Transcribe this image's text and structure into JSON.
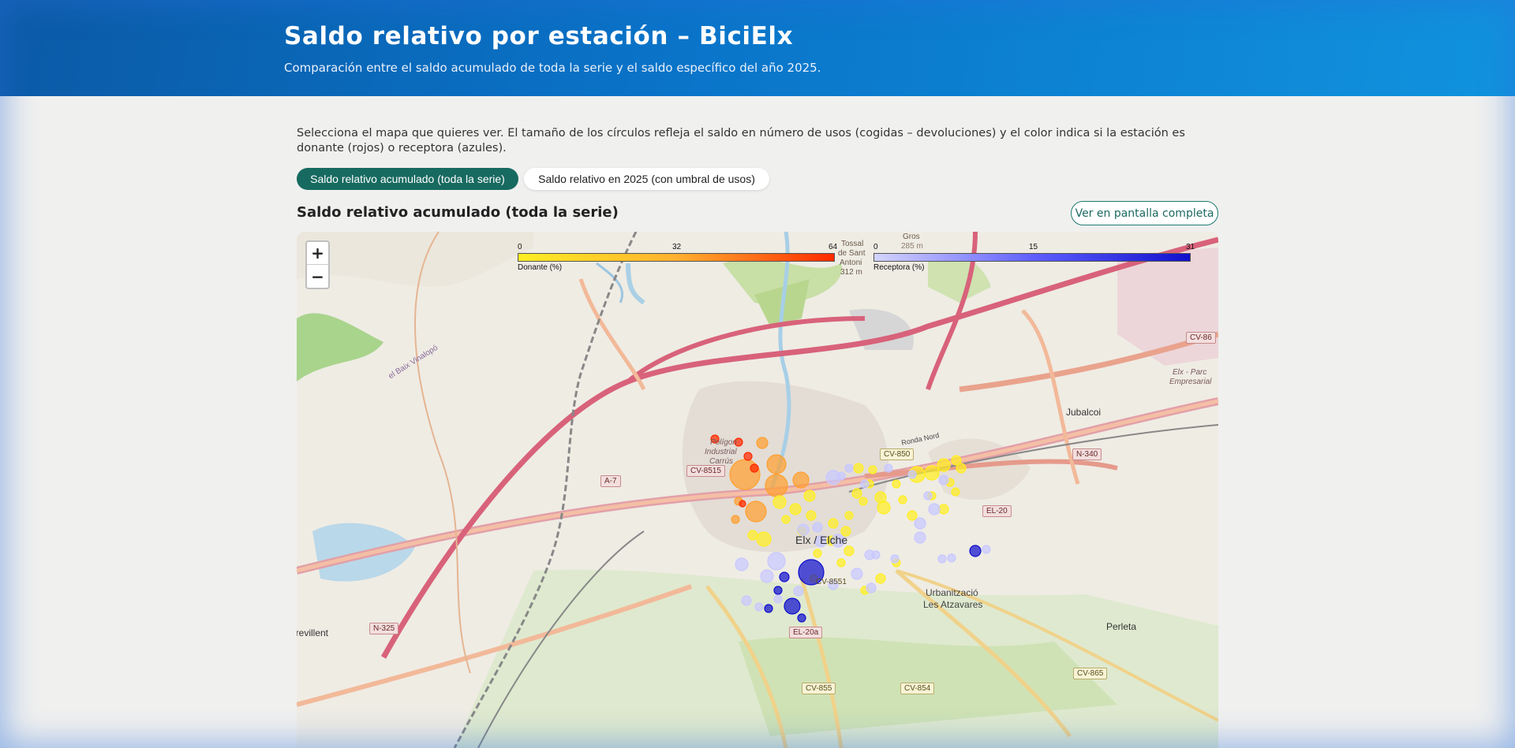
{
  "header": {
    "title": "Saldo relativo por estación – BiciElx",
    "subtitle": "Comparación entre el saldo acumulado de toda la serie y el saldo específico del año 2025."
  },
  "intro": "Selecciona el mapa que quieres ver. El tamaño de los círculos refleja el saldo en número de usos (cogidas – devoluciones) y el color indica si la estación es donante (rojos) o receptora (azules).",
  "tabs": {
    "active_label": "Saldo relativo acumulado (toda la serie)",
    "inactive_label": "Saldo relativo en 2025 (con umbral de usos)"
  },
  "map_section": {
    "title": "Saldo relativo acumulado (toda la serie)",
    "fullscreen_label": "Ver en pantalla completa"
  },
  "map": {
    "zoom_in": "+",
    "zoom_out": "−",
    "legend_donante": {
      "caption": "Donante (%)",
      "min": "0",
      "mid": "32",
      "max": "64"
    },
    "legend_receptora": {
      "caption": "Receptora (%)",
      "min": "0",
      "mid": "15",
      "max": "31"
    },
    "places": {
      "city": "Elx / Elche",
      "jubalcoi": "Jubalcoi",
      "urb1": "Urbanització",
      "urb2": "Les Atzavares",
      "perleta": "Perleta",
      "crevillent": "Crevillent",
      "baix": "el Baix Vinalopó",
      "parc1": "Elx - Parc",
      "parc2": "Empresarial",
      "poligon1": "Polígon",
      "poligon2": "Industrial",
      "poligon3": "Carrús",
      "tossal1": "Tossal",
      "tossal2": "de Sant",
      "tossal3": "Antoni",
      "tossal4": "312 m",
      "gros1": "Gros",
      "gros2": "285 m",
      "ronda": "Ronda Nord"
    },
    "roads": {
      "a7": "A-7",
      "cv8515": "CV-8515",
      "cv850": "CV-850",
      "el20": "EL-20",
      "n340": "N-340",
      "cv86": "CV-86",
      "n325": "N-325",
      "el20a": "EL-20a",
      "cv855": "CV-855",
      "cv854": "CV-854",
      "cv865": "CV-865",
      "cv8551": "CV-8551"
    },
    "colors": {
      "donante_low": "#ffee22",
      "donante_mid": "#ffa030",
      "donante_high": "#ff2a00",
      "receptora_low": "#c8c8ff",
      "receptora_high": "#1010cc"
    }
  }
}
